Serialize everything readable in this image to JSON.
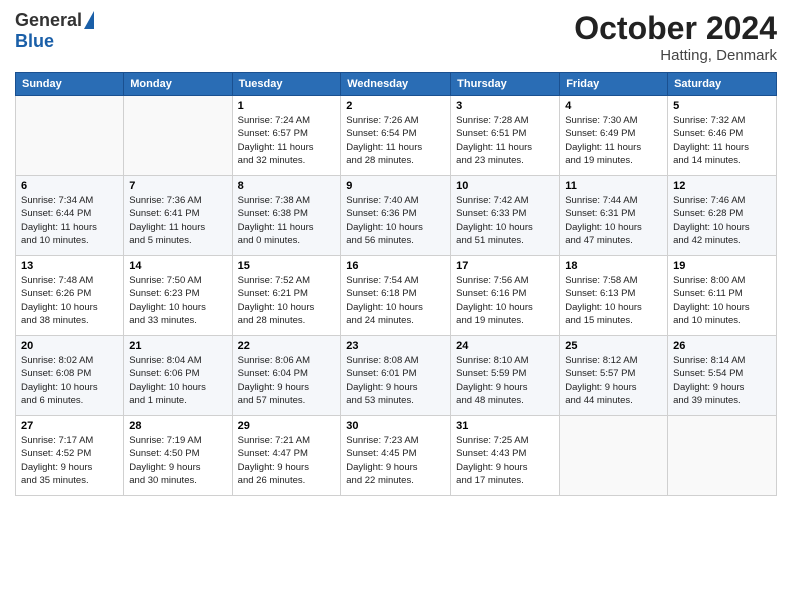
{
  "logo": {
    "general": "General",
    "blue": "Blue"
  },
  "title": "October 2024",
  "location": "Hatting, Denmark",
  "days_header": [
    "Sunday",
    "Monday",
    "Tuesday",
    "Wednesday",
    "Thursday",
    "Friday",
    "Saturday"
  ],
  "weeks": [
    [
      {
        "day": "",
        "info": ""
      },
      {
        "day": "",
        "info": ""
      },
      {
        "day": "1",
        "info": "Sunrise: 7:24 AM\nSunset: 6:57 PM\nDaylight: 11 hours\nand 32 minutes."
      },
      {
        "day": "2",
        "info": "Sunrise: 7:26 AM\nSunset: 6:54 PM\nDaylight: 11 hours\nand 28 minutes."
      },
      {
        "day": "3",
        "info": "Sunrise: 7:28 AM\nSunset: 6:51 PM\nDaylight: 11 hours\nand 23 minutes."
      },
      {
        "day": "4",
        "info": "Sunrise: 7:30 AM\nSunset: 6:49 PM\nDaylight: 11 hours\nand 19 minutes."
      },
      {
        "day": "5",
        "info": "Sunrise: 7:32 AM\nSunset: 6:46 PM\nDaylight: 11 hours\nand 14 minutes."
      }
    ],
    [
      {
        "day": "6",
        "info": "Sunrise: 7:34 AM\nSunset: 6:44 PM\nDaylight: 11 hours\nand 10 minutes."
      },
      {
        "day": "7",
        "info": "Sunrise: 7:36 AM\nSunset: 6:41 PM\nDaylight: 11 hours\nand 5 minutes."
      },
      {
        "day": "8",
        "info": "Sunrise: 7:38 AM\nSunset: 6:38 PM\nDaylight: 11 hours\nand 0 minutes."
      },
      {
        "day": "9",
        "info": "Sunrise: 7:40 AM\nSunset: 6:36 PM\nDaylight: 10 hours\nand 56 minutes."
      },
      {
        "day": "10",
        "info": "Sunrise: 7:42 AM\nSunset: 6:33 PM\nDaylight: 10 hours\nand 51 minutes."
      },
      {
        "day": "11",
        "info": "Sunrise: 7:44 AM\nSunset: 6:31 PM\nDaylight: 10 hours\nand 47 minutes."
      },
      {
        "day": "12",
        "info": "Sunrise: 7:46 AM\nSunset: 6:28 PM\nDaylight: 10 hours\nand 42 minutes."
      }
    ],
    [
      {
        "day": "13",
        "info": "Sunrise: 7:48 AM\nSunset: 6:26 PM\nDaylight: 10 hours\nand 38 minutes."
      },
      {
        "day": "14",
        "info": "Sunrise: 7:50 AM\nSunset: 6:23 PM\nDaylight: 10 hours\nand 33 minutes."
      },
      {
        "day": "15",
        "info": "Sunrise: 7:52 AM\nSunset: 6:21 PM\nDaylight: 10 hours\nand 28 minutes."
      },
      {
        "day": "16",
        "info": "Sunrise: 7:54 AM\nSunset: 6:18 PM\nDaylight: 10 hours\nand 24 minutes."
      },
      {
        "day": "17",
        "info": "Sunrise: 7:56 AM\nSunset: 6:16 PM\nDaylight: 10 hours\nand 19 minutes."
      },
      {
        "day": "18",
        "info": "Sunrise: 7:58 AM\nSunset: 6:13 PM\nDaylight: 10 hours\nand 15 minutes."
      },
      {
        "day": "19",
        "info": "Sunrise: 8:00 AM\nSunset: 6:11 PM\nDaylight: 10 hours\nand 10 minutes."
      }
    ],
    [
      {
        "day": "20",
        "info": "Sunrise: 8:02 AM\nSunset: 6:08 PM\nDaylight: 10 hours\nand 6 minutes."
      },
      {
        "day": "21",
        "info": "Sunrise: 8:04 AM\nSunset: 6:06 PM\nDaylight: 10 hours\nand 1 minute."
      },
      {
        "day": "22",
        "info": "Sunrise: 8:06 AM\nSunset: 6:04 PM\nDaylight: 9 hours\nand 57 minutes."
      },
      {
        "day": "23",
        "info": "Sunrise: 8:08 AM\nSunset: 6:01 PM\nDaylight: 9 hours\nand 53 minutes."
      },
      {
        "day": "24",
        "info": "Sunrise: 8:10 AM\nSunset: 5:59 PM\nDaylight: 9 hours\nand 48 minutes."
      },
      {
        "day": "25",
        "info": "Sunrise: 8:12 AM\nSunset: 5:57 PM\nDaylight: 9 hours\nand 44 minutes."
      },
      {
        "day": "26",
        "info": "Sunrise: 8:14 AM\nSunset: 5:54 PM\nDaylight: 9 hours\nand 39 minutes."
      }
    ],
    [
      {
        "day": "27",
        "info": "Sunrise: 7:17 AM\nSunset: 4:52 PM\nDaylight: 9 hours\nand 35 minutes."
      },
      {
        "day": "28",
        "info": "Sunrise: 7:19 AM\nSunset: 4:50 PM\nDaylight: 9 hours\nand 30 minutes."
      },
      {
        "day": "29",
        "info": "Sunrise: 7:21 AM\nSunset: 4:47 PM\nDaylight: 9 hours\nand 26 minutes."
      },
      {
        "day": "30",
        "info": "Sunrise: 7:23 AM\nSunset: 4:45 PM\nDaylight: 9 hours\nand 22 minutes."
      },
      {
        "day": "31",
        "info": "Sunrise: 7:25 AM\nSunset: 4:43 PM\nDaylight: 9 hours\nand 17 minutes."
      },
      {
        "day": "",
        "info": ""
      },
      {
        "day": "",
        "info": ""
      }
    ]
  ]
}
